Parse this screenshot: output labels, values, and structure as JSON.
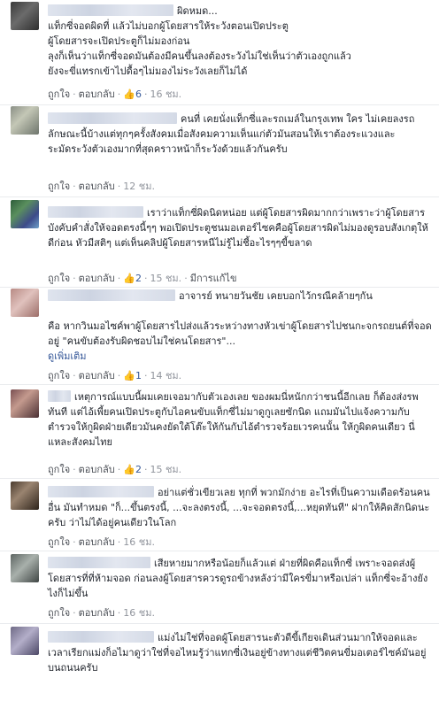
{
  "ui": {
    "like_label": "ถูกใจ",
    "reply_label": "ตอบกลับ",
    "dot": "·",
    "thumb_glyph": "👍"
  },
  "comments": [
    {
      "lead": "ผิดหมด...",
      "text": "แท็กซี่จอดผิดที่ แล้วไม่บอกผู้โดยสารให้ระวังตอนเปิดประตู\nผู้โดยสารจะเปิดประตูก็ไม่มองก่อน\nลุงก็เห็นว่าแท็กซี่จอดมันต้องมีคนขึ้นลงต้องระวังไม่ใช่เห็นว่าตัวเองถูกแล้ว\nยังจะขี่แทรกเข้าไปดื้อๆไม่มองไม่ระวังเลยก็ไม่ได้",
      "likes": "6",
      "time": "16 ชม."
    },
    {
      "lead": "",
      "text": "คนที่ เคยนั่งแท็กซี่และรถเมล์ในกรุงเทพ ใคร ไม่เคยลงรถ ลักษณะนี้บ้างแต่ทุกๆครั้งสังคมเมื่อสังคมความเห็นแก่ตัวมันสอนให้เราต้องระแวงและระมัดระวังตัวเองมากที่สุดคราวหน้าก็ระวังด้วยแล้วกันครับ",
      "likes": "",
      "time": "12 ชม."
    },
    {
      "lead": "",
      "text": "เราว่าแท็กซี่ผิดนิดหน่อย แต่ผู้โดยสารผิดมากกว่าเพราะว่าผู้โดยสารบังคับคำสั่งให้จอดตรงนี้ๆๆ พอเปิดประตูชนมอเตอร์ไซคคือผู้โดยสารผิดไม่มองดูรอบสังเกตุให้ดีก่อน หัวมีสติๆ แต่เห็นคลิปผู้โดยสารหนีไม่รู้ไม่ชี้อะไรๆๆขี้ขลาด",
      "likes": "2",
      "time": "15 ชม.",
      "extra": "มีการแก้ไข"
    },
    {
      "lead": "",
      "text": "อาจารย์ ทนายวันชัย เคยบอกไว้กรณีคล้ายๆกัน\n\nคือ หากวินมอไซค์พาผู้โดยสารไปส่งแล้วระหว่างทางหัวเข่าผู้โดยสารไปชนกะจกรถยนต์ที่จอดอยู่ \"คนขับต้องรับผิดชอบไม่ใช่คนโดยสาร\"...",
      "more": "ดูเพิ่มเติม",
      "likes": "1",
      "time": "14 ชม."
    },
    {
      "lead": "",
      "text": "เหตุการณ์แบบนี้ผมเคยเจอมากับตัวเองเลย ของผมนี่หนักกว่าชนนี้อีกเลย ก็ต้องส่งรพทันที แต่ไอ้เพี้ยคนเปิดประตูกับไอคนขับแท็กซี่ไม่มาดูกูเลยซักนิด แถมมันไปแจ้งความกับตำรวจให้กูผิดฝ่ายเดียวมันคงยัดใต้โต๊ะให้กันกับไอ้ตำรวจร้อยเวรคนนั้น ให้กูผิดคนเดียว นี่แหละสังคมไทย",
      "likes": "2",
      "time": "15 ชม."
    },
    {
      "lead": "",
      "text": "อย่าแต่ชั่วเขียวเลย ทุกที่ พวกมักง่าย อะไรที่เป็นความเดือดร้อนคนอื่น มันทำหมด \"ก็...ขึ้นตรงนี้, ...จะลงตรงนี้, ...จะจอดตรงนี้,...หยุดทันที\" ฝากให้คิดสักนิดนะครับ ว่าไม่ได้อยู่คนเดียวในโลก",
      "likes": "",
      "time": "16 ชม."
    },
    {
      "lead": "",
      "text": "เสียหายมากหรือน้อยก็แล้วแต่ ฝ่ายที่ผิดคือแท็กซี่ เพราะจอดส่งผู้โดยสารที่ที่ห้ามจอด ก่อนลงผู้โดยสารควรดูรถข้างหลังว่ามีใครขี่มาหรือเปล่า แท็กซี่จะอ้างยังไงก็ไม่ขึ้น",
      "likes": "",
      "time": "16 ชม."
    },
    {
      "lead": "",
      "text": "แม่งไม่ใช่ที่จอดผู้โดยสารนะตัวดีขี้เกียจเดินส่วนมากให้จอดและเวลาเรียกแม่งก็อไมาดูว่าใช่ที่จอไหมรู้ว่าแทกซี่เงินอยู่ข้างทางแต่ชีวิตคนขี่มอเตอร์ไซค์มันอยู่บนถนนครับ",
      "likes": "",
      "time": ""
    }
  ]
}
